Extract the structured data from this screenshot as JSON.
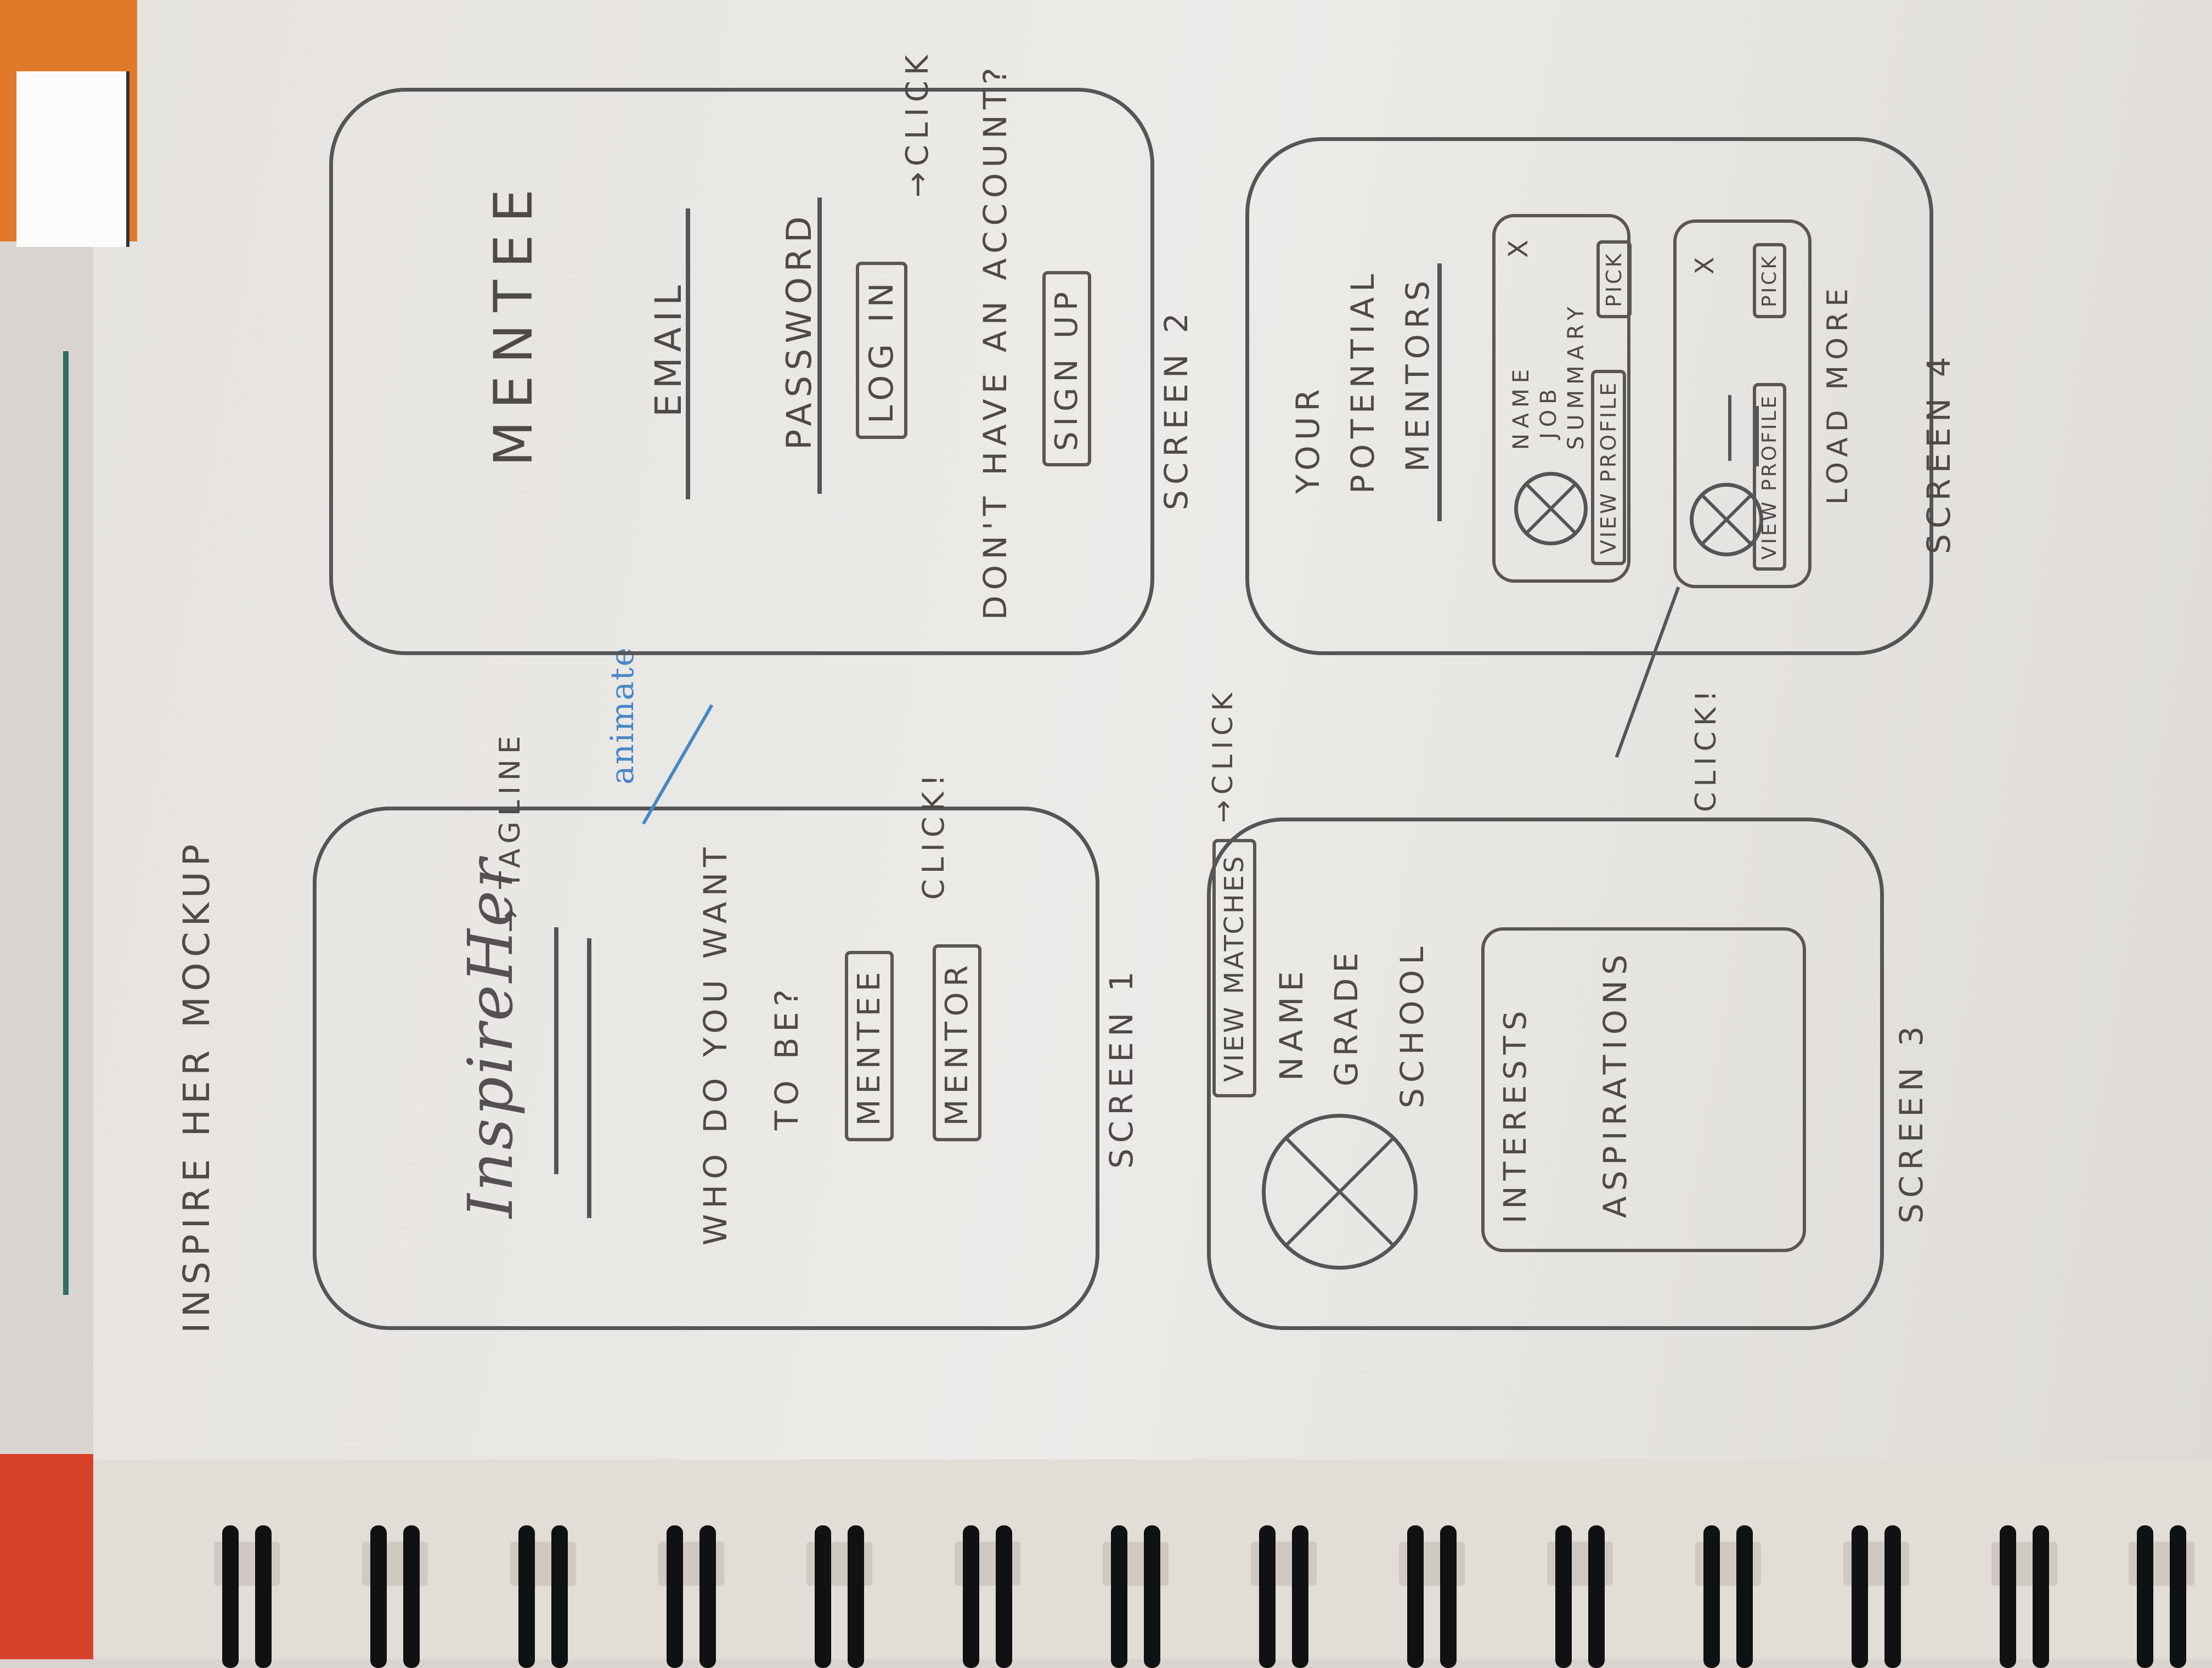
{
  "page": {
    "title": "INSPIRE HER MOCKUP"
  },
  "screen1": {
    "logo": "InspireHer",
    "tagline_arrow": "→ TAGLINE",
    "animate_note": "animate",
    "question": "WHO DO YOU WANT",
    "question_2": "TO BE?",
    "mentee_button": "MENTEE",
    "mentor_button": "MENTOR",
    "click_note": "CLICK!",
    "caption": "SCREEN 1"
  },
  "screen2": {
    "title": "MENTEE",
    "email_label": "EMAIL",
    "password_label": "PASSWORD",
    "login_button": "LOG IN",
    "login_click": "→CLICK",
    "no_account": "DON'T HAVE AN ACCOUNT?",
    "signup_button": "SIGN UP",
    "caption": "SCREEN 2"
  },
  "screen3": {
    "view_matches_button": "VIEW MATCHES",
    "click_note": "→CLICK",
    "name": "NAME",
    "grade": "GRADE",
    "school": "SCHOOL",
    "interests": "INTERESTS",
    "aspirations": "ASPIRATIONS",
    "caption": "SCREEN 3"
  },
  "screen4": {
    "heading_1": "YOUR",
    "heading_2": "POTENTIAL",
    "heading_3": "MENTORS",
    "card1": {
      "name": "NAME",
      "job": "JOB",
      "summary": "SUMMARY",
      "view_profile": "VIEW PROFILE",
      "pick": "PICK",
      "close": "X"
    },
    "card2": {
      "view_profile": "VIEW PROFILE",
      "pick": "PICK",
      "close": "X"
    },
    "load_more": "LOAD MORE",
    "click_note": "CLICK!",
    "caption": "SCREEN 4"
  }
}
